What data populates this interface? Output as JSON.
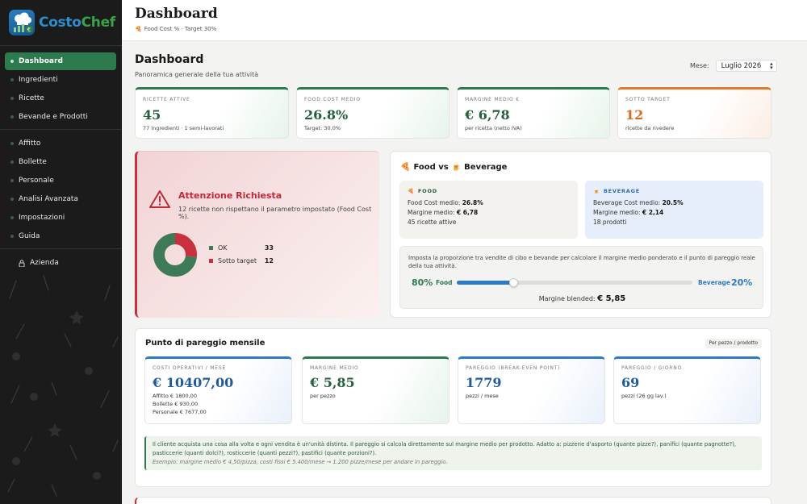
{
  "app": {
    "logo_part1": "Costo",
    "logo_part2": "Chef"
  },
  "sidebar": {
    "items": [
      {
        "label": "Dashboard"
      },
      {
        "label": "Ingredienti"
      },
      {
        "label": "Ricette"
      },
      {
        "label": "Bevande e Prodotti"
      },
      {
        "label": "Affitto"
      },
      {
        "label": "Bollette"
      },
      {
        "label": "Personale"
      },
      {
        "label": "Analisi Avanzata"
      },
      {
        "label": "Impostazioni"
      },
      {
        "label": "Guida"
      },
      {
        "label": "Azienda"
      }
    ]
  },
  "header": {
    "title": "Dashboard",
    "subtitle": "Food Cost % · Target 30%"
  },
  "page": {
    "title": "Dashboard",
    "description": "Panoramica generale della tua attività",
    "month_label": "Mese:",
    "month_value": "Luglio 2026"
  },
  "kpis": [
    {
      "label": "RICETTE ATTIVE",
      "value": "45",
      "note": "77 ingredienti · 1 semi-lavorati"
    },
    {
      "label": "FOOD COST MEDIO",
      "value": "26.8%",
      "note": "Target: 30.0%"
    },
    {
      "label": "MARGINE MEDIO €",
      "value": "€ 6,78",
      "note": "per ricetta (netto IVA)"
    },
    {
      "label": "SOTTO TARGET",
      "value": "12",
      "note": "ricette da rivedere"
    }
  ],
  "alert": {
    "title": "Attenzione Richiesta",
    "message": "12 ricette non rispettano il parametro impostato (Food Cost %).",
    "legend": [
      {
        "label": "OK",
        "value": "33",
        "color": "#3f7a58"
      },
      {
        "label": "Sotto target",
        "value": "12",
        "color": "#c8303e"
      }
    ],
    "ok_count": 33,
    "under_count": 12
  },
  "food_bev": {
    "title": "Food vs 🍺 Beverage",
    "food": {
      "label": "FOOD",
      "cost_label": "Food Cost medio:",
      "cost_value": "26.8%",
      "margin_label": "Margine medio:",
      "margin_value": "€ 6,78",
      "count": "45 ricette attive"
    },
    "beverage": {
      "label": "BEVERAGE",
      "cost_label": "Beverage Cost medio:",
      "cost_value": "20.5%",
      "margin_label": "Margine medio:",
      "margin_value": "€ 2,14",
      "count": "18 prodotti"
    },
    "mix_text": "Imposta la proporzione tra vendite di cibo e bevande per calcolare il margine medio ponderato e il punto di pareggio reale della tua attività.",
    "food_pct": "80%",
    "food_label": "Food",
    "bev_label": "Beverage",
    "bev_pct": "20%",
    "slider_fraction": 0.8,
    "blended_label": "Margine blended:",
    "blended_value": "€ 5,85"
  },
  "breakeven": {
    "title": "Punto di pareggio mensile",
    "tag": "Per pezzo / prodotto",
    "cards": [
      {
        "label": "COSTI OPERATIVI / MESE",
        "value": "€ 10407,00",
        "notes": [
          "Affitto € 1800,00",
          "Bollette € 930,00",
          "Personale € 7677,00"
        ]
      },
      {
        "label": "MARGINE MEDIO",
        "value": "€ 5,85",
        "notes": [
          "per pezzo"
        ]
      },
      {
        "label": "PAREGGIO (BREAK-EVEN POINT)",
        "value": "1779",
        "notes": [
          "pezzi / mese"
        ]
      },
      {
        "label": "PAREGGIO / GIORNO",
        "value": "69",
        "notes": [
          "pezzi (26 gg lav.)"
        ]
      }
    ],
    "info": "Il cliente acquista una cosa alla volta e ogni vendita è un'unità distinta. Il pareggio si calcola direttamente sul margine medio per prodotto. Adatto a: pizzerie d'asporto (quante pizze?), panifici (quante pagnotte?), pasticcerie (quanti dolci?), rosticcerie (quanti pezzi?), pastifici (quante porzioni?).",
    "example": "Esempio: margine medio € 4,50/pizza, costi fissi € 5.400/mese → 1.200 pizze/mese per andare in pareggio."
  },
  "colors": {
    "accent_green": "#2e7a4f",
    "accent_blue": "#2d7bc4",
    "alert_red": "#c8303e",
    "warn_orange": "#e07b2e"
  }
}
